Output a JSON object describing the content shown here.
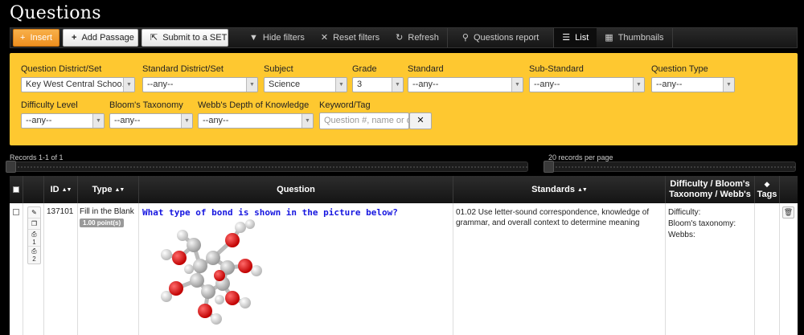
{
  "page": {
    "title": "Questions"
  },
  "toolbar": {
    "insert": "Insert",
    "add_passage": "Add Passage",
    "submit_set": "Submit to a SET",
    "hide_filters": "Hide filters",
    "reset_filters": "Reset filters",
    "refresh": "Refresh",
    "questions_report": "Questions report",
    "list": "List",
    "thumbnails": "Thumbnails"
  },
  "filters": {
    "district_set": {
      "label": "Question District/Set",
      "value": "Key West Central Schoo..."
    },
    "standard_district": {
      "label": "Standard District/Set",
      "value": "--any--"
    },
    "subject": {
      "label": "Subject",
      "value": "Science"
    },
    "grade": {
      "label": "Grade",
      "value": "3"
    },
    "standard": {
      "label": "Standard",
      "value": "--any--"
    },
    "sub_standard": {
      "label": "Sub-Standard",
      "value": "--any--"
    },
    "question_type": {
      "label": "Question Type",
      "value": "--any--"
    },
    "difficulty": {
      "label": "Difficulty Level",
      "value": "--any--"
    },
    "blooms": {
      "label": "Bloom's Taxonomy",
      "value": "--any--"
    },
    "webbs": {
      "label": "Webb's Depth of Knowledge",
      "value": "--any--"
    },
    "keyword": {
      "label": "Keyword/Tag",
      "placeholder": "Question #, name or de"
    }
  },
  "records": {
    "label": "Records 1-1 of 1",
    "per_page": "20 records per page"
  },
  "table": {
    "columns": {
      "id": "ID",
      "type": "Type",
      "question": "Question",
      "standards": "Standards",
      "difficulty_1": "Difficulty / Bloom's",
      "difficulty_2": "Taxonomy / Webb's",
      "tags": "Tags"
    },
    "rows": [
      {
        "id": "137101",
        "type": "Fill in the Blank",
        "points": "1.00 point(s)",
        "question": "What type of bond is shown in the picture below?",
        "standard": "01.02 Use letter-sound correspondence, knowledge of grammar, and overall context to determine meaning",
        "difficulty": "Difficulty:",
        "blooms": "Bloom's taxonomy:",
        "webbs": "Webbs:",
        "print_1": "1",
        "print_2": "2"
      }
    ]
  }
}
